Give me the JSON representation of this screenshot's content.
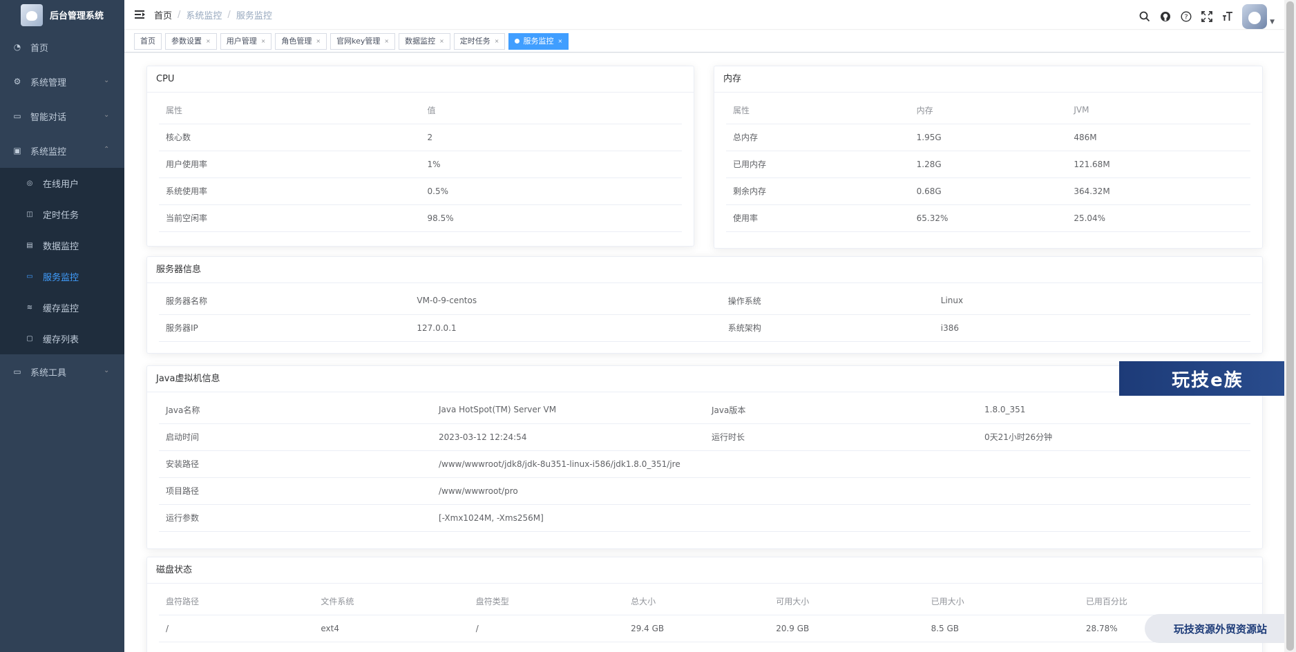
{
  "app": {
    "title": "后台管理系统"
  },
  "sidebar": {
    "items": [
      {
        "label": "首页",
        "icon": "dashboard-icon"
      },
      {
        "label": "系统管理",
        "icon": "gear-icon"
      },
      {
        "label": "智能对话",
        "icon": "chat-icon"
      },
      {
        "label": "系统监控",
        "icon": "monitor-icon"
      },
      {
        "label": "系统工具",
        "icon": "tool-icon"
      }
    ],
    "monitor_children": [
      {
        "label": "在线用户",
        "icon": "online-icon"
      },
      {
        "label": "定时任务",
        "icon": "job-icon"
      },
      {
        "label": "数据监控",
        "icon": "druid-icon"
      },
      {
        "label": "服务监控",
        "icon": "server-icon"
      },
      {
        "label": "缓存监控",
        "icon": "redis-icon"
      },
      {
        "label": "缓存列表",
        "icon": "redis-list-icon"
      }
    ]
  },
  "breadcrumb": {
    "home": "首页",
    "parent": "系统监控",
    "current": "服务监控"
  },
  "tags": [
    {
      "label": "首页"
    },
    {
      "label": "参数设置"
    },
    {
      "label": "用户管理"
    },
    {
      "label": "角色管理"
    },
    {
      "label": "官网key管理"
    },
    {
      "label": "数据监控"
    },
    {
      "label": "定时任务"
    },
    {
      "label": "服务监控"
    }
  ],
  "cpu": {
    "title": "CPU",
    "headers": [
      "属性",
      "值"
    ],
    "rows": [
      [
        "核心数",
        "2"
      ],
      [
        "用户使用率",
        "1%"
      ],
      [
        "系统使用率",
        "0.5%"
      ],
      [
        "当前空闲率",
        "98.5%"
      ]
    ]
  },
  "memory": {
    "title": "内存",
    "headers": [
      "属性",
      "内存",
      "JVM"
    ],
    "rows": [
      [
        "总内存",
        "1.95G",
        "486M"
      ],
      [
        "已用内存",
        "1.28G",
        "121.68M"
      ],
      [
        "剩余内存",
        "0.68G",
        "364.32M"
      ],
      [
        "使用率",
        "65.32%",
        "25.04%"
      ]
    ]
  },
  "server": {
    "title": "服务器信息",
    "rows": [
      [
        "服务器名称",
        "VM-0-9-centos",
        "操作系统",
        "Linux"
      ],
      [
        "服务器IP",
        "127.0.0.1",
        "系统架构",
        "i386"
      ]
    ]
  },
  "jvm": {
    "title": "Java虚拟机信息",
    "rows": [
      [
        "Java名称",
        "Java HotSpot(TM) Server VM",
        "Java版本",
        "1.8.0_351"
      ],
      [
        "启动时间",
        "2023-03-12 12:24:54",
        "运行时长",
        "0天21小时26分钟"
      ]
    ],
    "wide_rows": [
      [
        "安装路径",
        "/www/wwwroot/jdk8/jdk-8u351-linux-i586/jdk1.8.0_351/jre"
      ],
      [
        "项目路径",
        "/www/wwwroot/pro"
      ],
      [
        "运行参数",
        "[-Xmx1024M, -Xms256M]"
      ]
    ]
  },
  "disk": {
    "title": "磁盘状态",
    "headers": [
      "盘符路径",
      "文件系统",
      "盘符类型",
      "总大小",
      "可用大小",
      "已用大小",
      "已用百分比"
    ],
    "rows": [
      [
        "/",
        "ext4",
        "/",
        "29.4 GB",
        "20.9 GB",
        "8.5 GB",
        "28.78%"
      ]
    ]
  },
  "watermarks": {
    "top": "玩技e族",
    "bottom": "玩技资源外贸资源站"
  },
  "colors": {
    "sidebar_bg": "#304156",
    "submenu_bg": "#1f2d3d",
    "accent": "#409eff"
  }
}
